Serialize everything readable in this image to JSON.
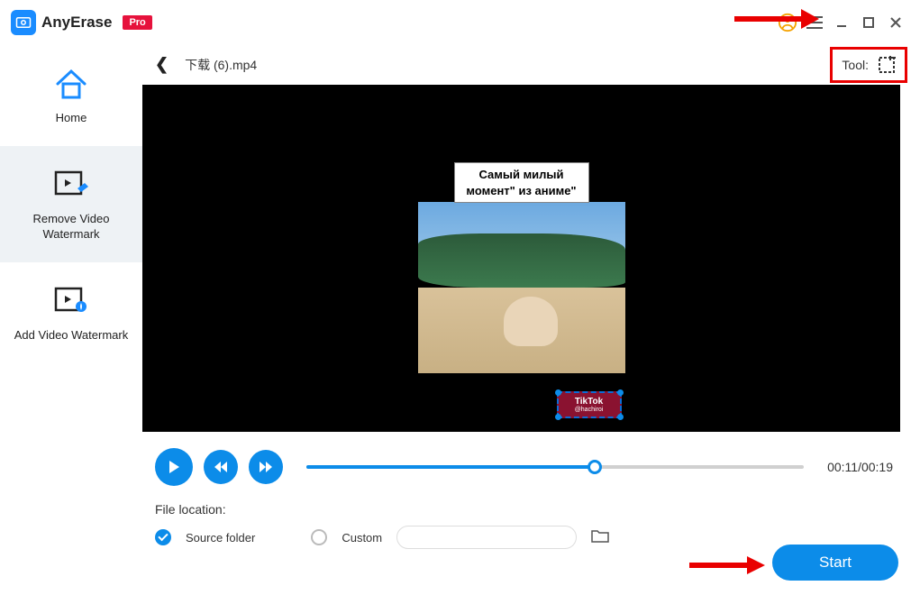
{
  "app": {
    "name": "AnyErase",
    "badge": "Pro"
  },
  "sidebar": {
    "items": [
      {
        "label": "Home"
      },
      {
        "label": "Remove Video Watermark"
      },
      {
        "label": "Add Video Watermark"
      }
    ],
    "activeIndex": 1
  },
  "file": {
    "name": "下载 (6).mp4"
  },
  "tool": {
    "label": "Tool:"
  },
  "video": {
    "subtitle_line1": "Самый милый",
    "subtitle_line2": "момент\" из аниме\"",
    "watermark_brand": "TikTok",
    "watermark_user": "@hachiroi"
  },
  "playback": {
    "current": "00:11",
    "total": "00:19",
    "progressPercent": 58,
    "timeDisplay": "00:11/00:19"
  },
  "fileLocation": {
    "title": "File location:",
    "sourceLabel": "Source folder",
    "customLabel": "Custom",
    "selected": "source"
  },
  "actions": {
    "start": "Start"
  },
  "colors": {
    "accent": "#0c8ce9",
    "highlight": "#e90000",
    "proBadge": "#e6123c"
  }
}
